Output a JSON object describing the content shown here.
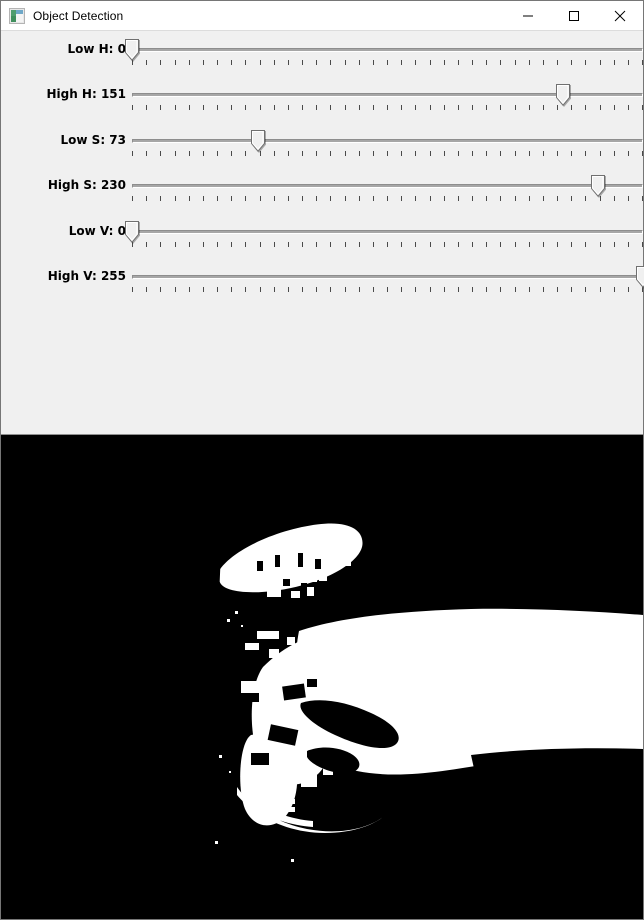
{
  "window": {
    "title": "Object Detection",
    "icon": "application-image-icon",
    "background_color": "#f0f0f0",
    "border_color": "#767676",
    "controls": [
      {
        "name": "minimize",
        "label": "—"
      },
      {
        "name": "maximize",
        "label": "□"
      },
      {
        "name": "close",
        "label": "✕"
      }
    ]
  },
  "panel": {
    "sliders": [
      {
        "name": "low-h",
        "label": "Low H: 0",
        "param": "Low H",
        "value": 0,
        "min": 0,
        "max": 179,
        "thumb_pct": 0.0,
        "ticks": 36
      },
      {
        "name": "high-h",
        "label": "High H: 151",
        "param": "High H",
        "value": 151,
        "min": 0,
        "max": 179,
        "thumb_pct": 84.4,
        "ticks": 36
      },
      {
        "name": "low-s",
        "label": "Low S: 73",
        "param": "Low S",
        "value": 73,
        "min": 0,
        "max": 255,
        "thumb_pct": 24.6,
        "ticks": 36
      },
      {
        "name": "high-s",
        "label": "High S: 230",
        "param": "High S",
        "value": 230,
        "min": 0,
        "max": 255,
        "thumb_pct": 91.2,
        "ticks": 36
      },
      {
        "name": "low-v",
        "label": "Low V: 0",
        "param": "Low V",
        "value": 0,
        "min": 0,
        "max": 255,
        "thumb_pct": 0.0,
        "ticks": 36
      },
      {
        "name": "high-v",
        "label": "High V: 255",
        "param": "High V",
        "value": 255,
        "min": 0,
        "max": 255,
        "thumb_pct": 100.0,
        "ticks": 36
      }
    ]
  },
  "viewport": {
    "name": "mask-preview",
    "description": "binary threshold mask of a hand holding a drinking glass",
    "background_color": "#000000",
    "foreground_color": "#ffffff"
  }
}
